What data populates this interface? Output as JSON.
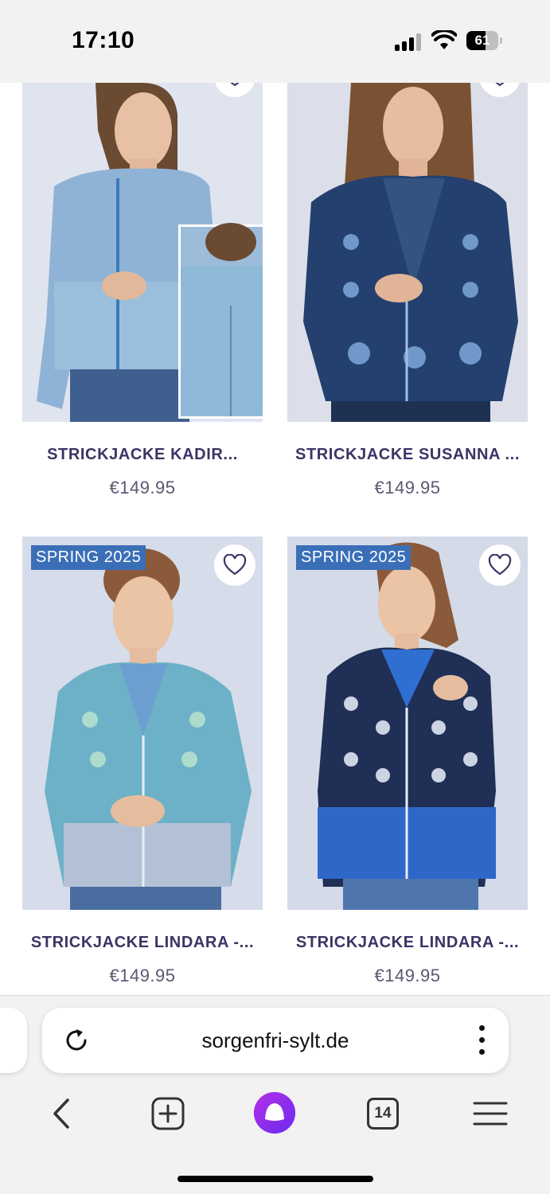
{
  "status_bar": {
    "time": "17:10",
    "battery_level": "61",
    "icons": [
      "cellular-signal-icon",
      "wifi-icon",
      "battery-icon"
    ]
  },
  "products": [
    {
      "title": "STRICKJACKE KADIR...",
      "price": "€149.95",
      "badge": "",
      "colors": {
        "bg": "#dde3ee",
        "knit": "#7fa9cf",
        "accent": "#b9cfe6"
      }
    },
    {
      "title": "STRICKJACKE SUSANNA ...",
      "price": "€149.95",
      "badge": "",
      "colors": {
        "bg": "#d9dde8",
        "knit": "#23406e",
        "accent": "#7ea8d8"
      }
    },
    {
      "title": "STRICKJACKE LINDARA -...",
      "price": "€149.95",
      "badge": "SPRING 2025",
      "colors": {
        "bg": "#d5dbe8",
        "knit": "#6fb3c9",
        "accent": "#b8e0cf"
      }
    },
    {
      "title": "STRICKJACKE LINDARA -...",
      "price": "€149.95",
      "badge": "SPRING 2025",
      "colors": {
        "bg": "#d3d9e6",
        "knit": "#1f2f55",
        "accent": "#2f67c9"
      }
    }
  ],
  "browser": {
    "url": "sorgenfri-sylt.de",
    "tab_count": "14",
    "icons": [
      "reload-icon",
      "more-options-icon",
      "back-icon",
      "new-tab-icon",
      "alice-assistant-icon",
      "tabs-icon",
      "menu-icon"
    ]
  }
}
